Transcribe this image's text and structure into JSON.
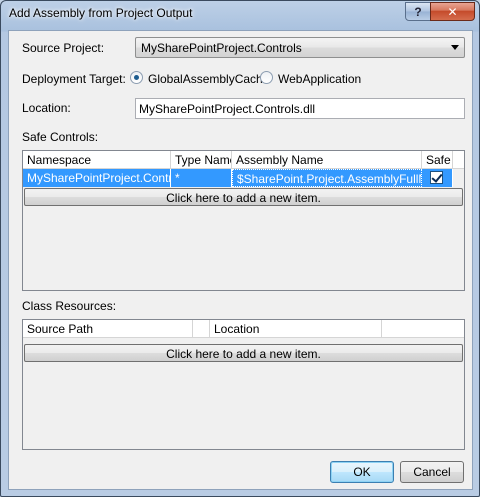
{
  "window": {
    "title": "Add Assembly from Project Output",
    "help_label": "?",
    "close_label": "✕"
  },
  "form": {
    "source_project_label": "Source Project:",
    "source_project_value": "MySharePointProject.Controls",
    "deployment_target_label": "Deployment Target:",
    "deployment_options": [
      {
        "label": "GlobalAssemblyCache",
        "selected": true
      },
      {
        "label": "WebApplication",
        "selected": false
      }
    ],
    "location_label": "Location:",
    "location_value": "MySharePointProject.Controls.dll"
  },
  "safe_controls": {
    "label": "Safe Controls:",
    "columns": [
      "Namespace",
      "Type Name",
      "Assembly Name",
      "Safe"
    ],
    "rows": [
      {
        "namespace": "MySharePointProject.Controls",
        "type_name": "*",
        "assembly_name": "$SharePoint.Project.AssemblyFullName$",
        "safe": true
      }
    ],
    "add_item_label": "Click here to add a new item."
  },
  "class_resources": {
    "label": "Class Resources:",
    "columns": [
      "Source Path",
      "",
      "Location"
    ],
    "add_item_label": "Click here to add a new item."
  },
  "buttons": {
    "ok_label": "OK",
    "cancel_label": "Cancel"
  },
  "colors": {
    "selection": "#3399ff",
    "dialog_face": "#f0f0f0",
    "frame": "#b9cce4"
  }
}
